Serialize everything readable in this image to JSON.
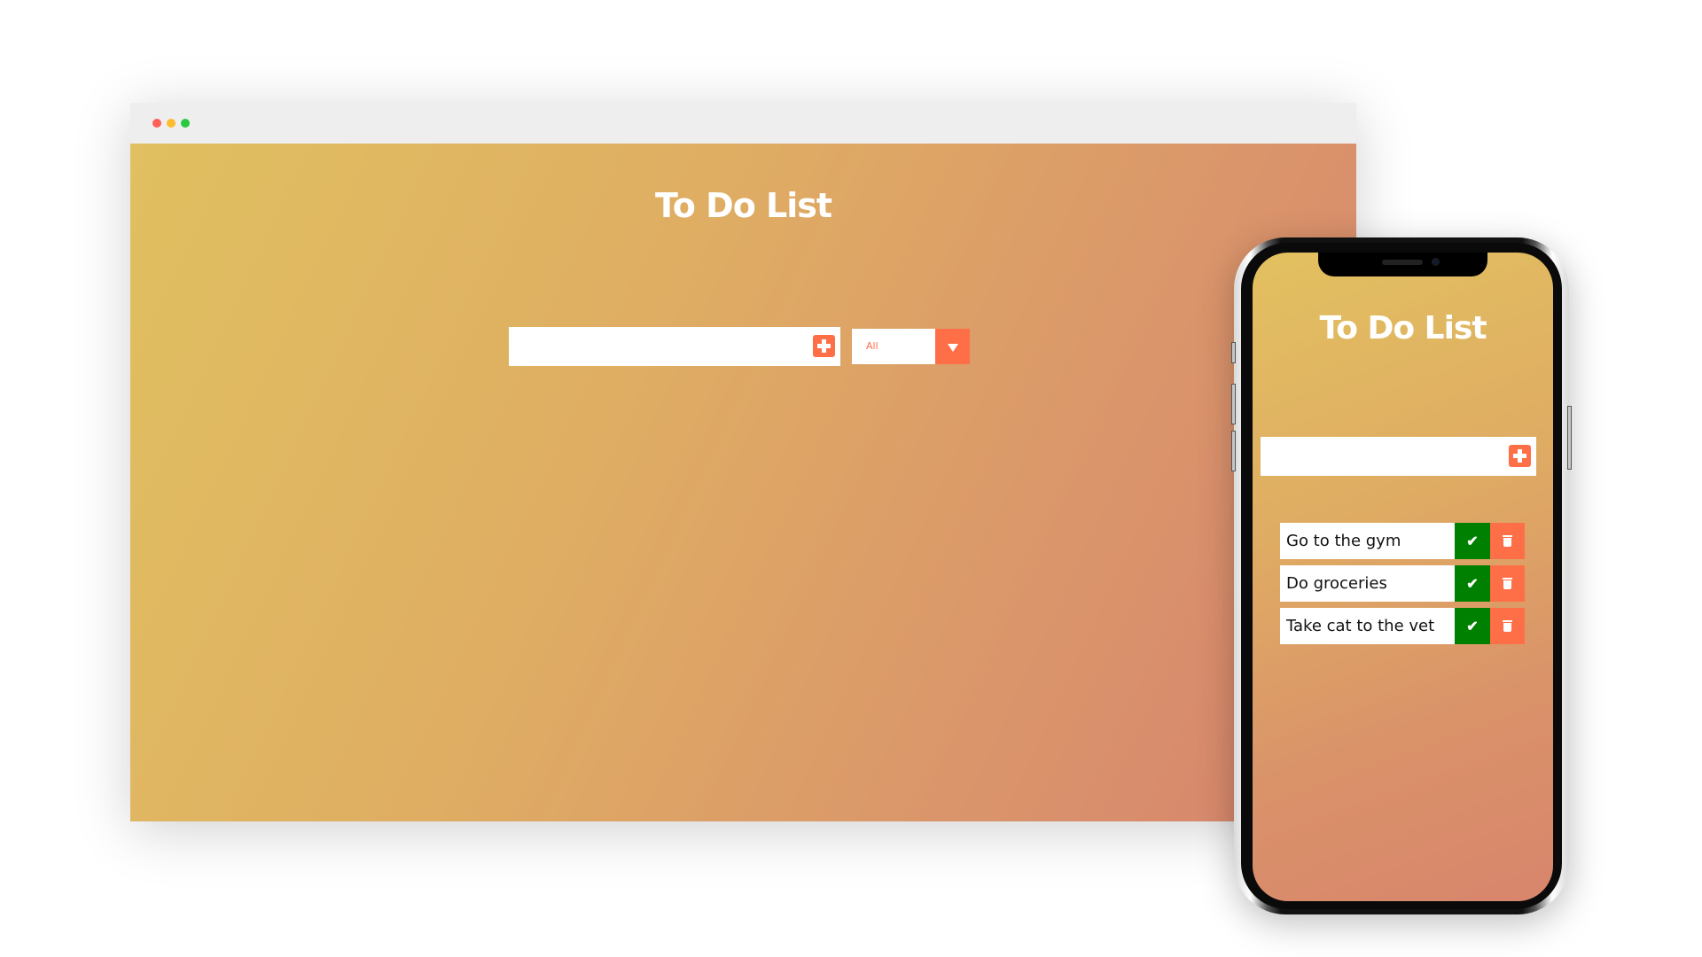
{
  "desktop": {
    "window_controls": [
      "close",
      "minimize",
      "maximize"
    ],
    "title": "To Do List",
    "input": {
      "value": "",
      "placeholder": ""
    },
    "add_button_icon": "plus-square-icon",
    "filter": {
      "selected": "All",
      "arrow_icon": "caret-down-icon"
    }
  },
  "mobile": {
    "title": "To Do List",
    "input": {
      "value": "",
      "placeholder": ""
    },
    "add_button_icon": "plus-square-icon",
    "todos": [
      {
        "text": "Go to the gym",
        "complete_icon": "check-icon",
        "delete_icon": "trash-icon"
      },
      {
        "text": "Do groceries",
        "complete_icon": "check-icon",
        "delete_icon": "trash-icon"
      },
      {
        "text": "Take cat to the vet",
        "complete_icon": "check-icon",
        "delete_icon": "trash-icon"
      }
    ],
    "check_glyph": "✔"
  },
  "colors": {
    "accent": "#ff6f47",
    "complete": "#008000",
    "gradient_start": "#e0c060",
    "gradient_end": "#d6836d",
    "title_text": "#ffffff"
  }
}
